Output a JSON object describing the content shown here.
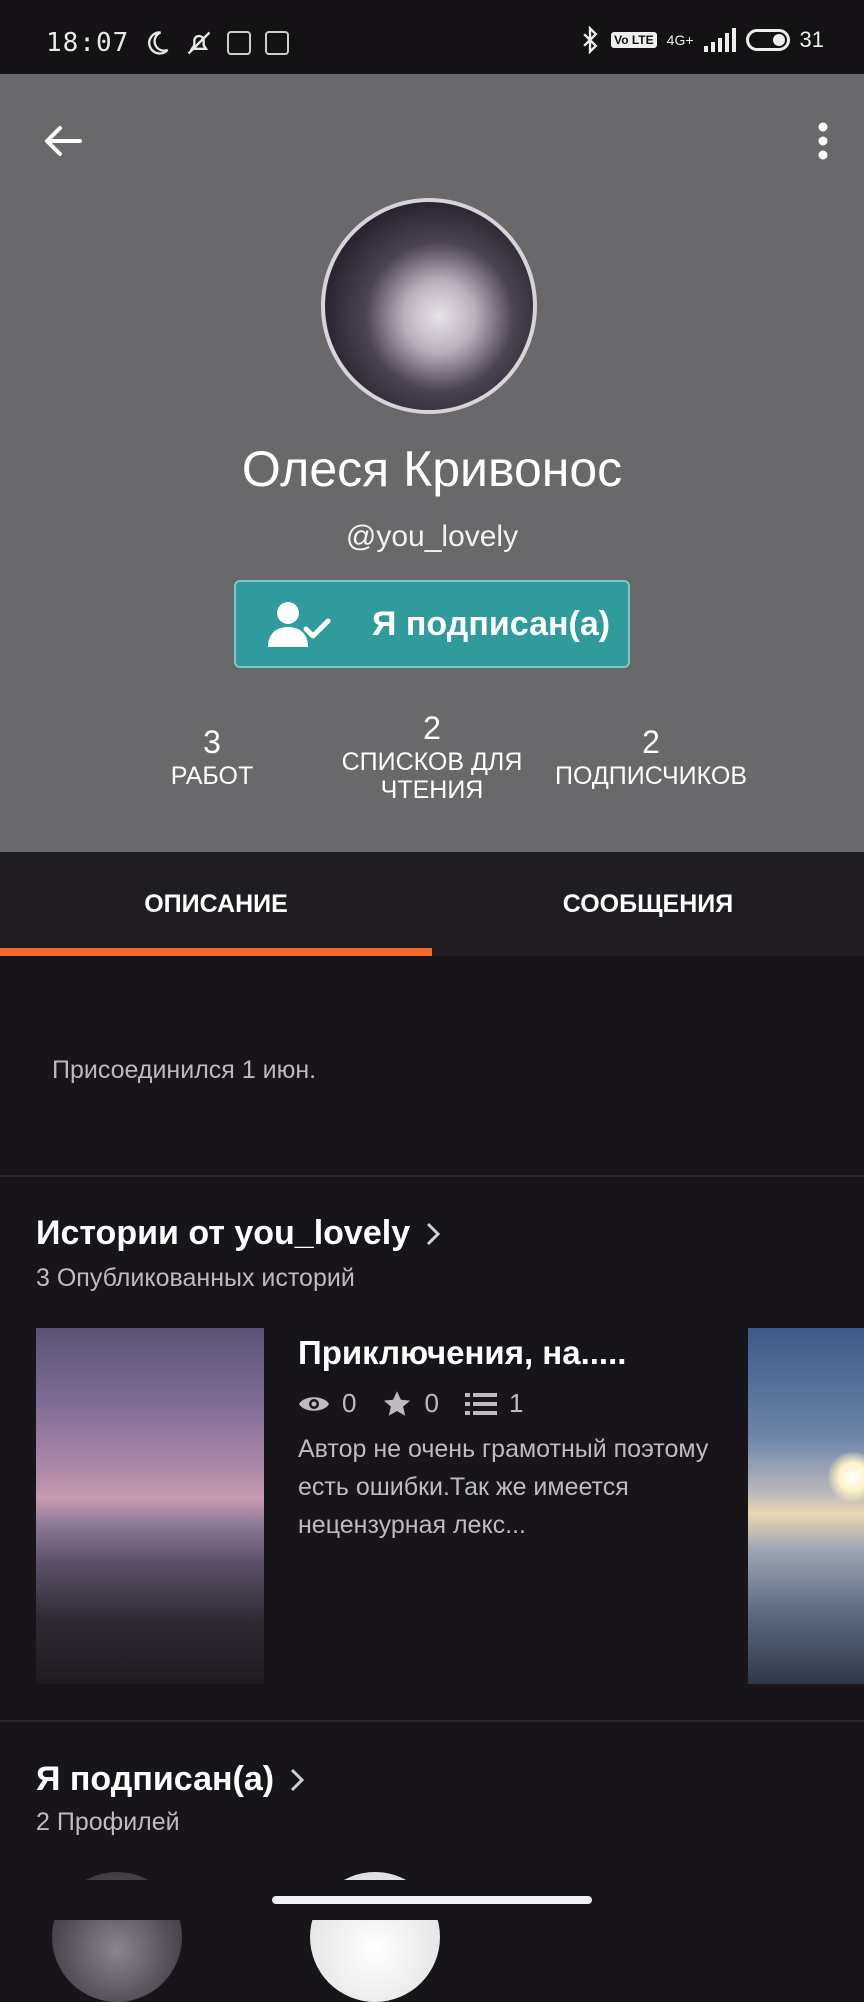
{
  "status_bar": {
    "time": "18:07",
    "volte": "Vo LTE",
    "network": "4G+",
    "battery": "31"
  },
  "profile": {
    "name": "Олеся Кривонос",
    "handle": "@you_lovely",
    "follow_button": "Я подписан(а)",
    "stats": [
      {
        "value": "3",
        "label": "РАБОТ"
      },
      {
        "value": "2",
        "label": "СПИСКОВ ДЛЯ ЧТЕНИЯ"
      },
      {
        "value": "2",
        "label": "ПОДПИСЧИКОВ"
      }
    ]
  },
  "tabs": [
    {
      "label": "ОПИСАНИЕ",
      "active": true
    },
    {
      "label": "СООБЩЕНИЯ",
      "active": false
    }
  ],
  "about": {
    "joined": "Присоединился 1 июн."
  },
  "stories_section": {
    "title": "Истории от you_lovely",
    "subtitle": "3 Опубликованных историй",
    "story": {
      "title": "Приключения, на.....",
      "views": "0",
      "votes": "0",
      "parts": "1",
      "description": "Автор не очень грамотный поэтому есть ошибки.Так же имеется нецензурная лекс..."
    }
  },
  "following_section": {
    "title": "Я подписан(а)",
    "subtitle": "2 Профилей"
  },
  "icons": {
    "back": "arrow-left-icon",
    "more": "more-vertical-icon",
    "follow": "user-check-icon",
    "views": "eye-icon",
    "votes": "star-icon",
    "parts": "list-icon",
    "chevron": "chevron-right-icon"
  },
  "colors": {
    "header_bg": "#69686a",
    "follow_button": "#2f9b9d",
    "active_tab_indicator": "#f26a2c",
    "page_bg": "#17151a"
  }
}
